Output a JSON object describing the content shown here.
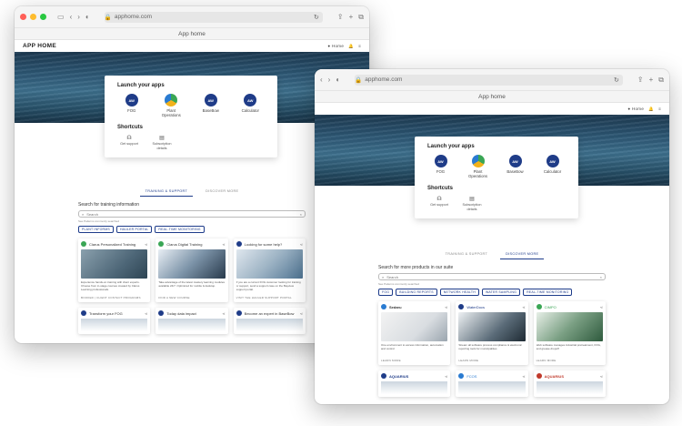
{
  "window1": {
    "url": "apphome.com",
    "tab_title": "App home",
    "header": {
      "title": "APP HOME",
      "user": "Home"
    },
    "launch": {
      "heading": "Launch your apps",
      "apps": [
        {
          "label": "FOG",
          "color": "#1f3c88",
          "icon": "AW"
        },
        {
          "label": "Plant Operations",
          "color": "#3aa655",
          "icon": ""
        },
        {
          "label": "BaseBow",
          "color": "#1f3c88",
          "icon": "AW"
        },
        {
          "label": "Calculator",
          "color": "#1f3c88",
          "icon": "AW"
        }
      ]
    },
    "shortcuts": {
      "heading": "Shortcuts",
      "items": [
        {
          "label": "Get support"
        },
        {
          "label": "Subscription details"
        }
      ]
    },
    "tabs": [
      "TRAINING & SUPPORT",
      "DISCOVER MORE"
    ],
    "search": {
      "label": "Search for training information",
      "placeholder": "Search",
      "hint": "See Patterns commonly searched"
    },
    "chips": [
      "PLANT INFORMS",
      "HAULER PORTAL",
      "REAL-TIME MONITORING"
    ],
    "cards": [
      {
        "title": "Clarus Personalized Training",
        "text": "Experience hands-on training with client experts. Choose from in-stage courses created by Clarus Learning professionals.",
        "foot": "BOOKED | CLIENT CONTACT PROGRAMS"
      },
      {
        "title": "Clarus Digital Training",
        "text": "Take advantage of the latest mastery learning modules available 24/7. Optimized for mobile & desktop.",
        "foot": "FIND A NEW COURSE"
      },
      {
        "title": "Looking for some help?",
        "text": "If you are a current FOG customer looking for training or support, send a support case on the Bayview support portal.",
        "foot": "VISIT THE HAULER SUPPORT PORTAL"
      }
    ],
    "more_cards": [
      "Transform your FOG",
      "Today data impact",
      "Become an expert in BaseBow"
    ]
  },
  "window2": {
    "url": "apphome.com",
    "tab_title": "App home",
    "header": {
      "user": "Home"
    },
    "launch": {
      "heading": "Launch your apps",
      "apps": [
        {
          "label": "FOG",
          "color": "#1f3c88",
          "icon": "AW"
        },
        {
          "label": "Plant Operations",
          "color": "#3aa655",
          "icon": ""
        },
        {
          "label": "BaseBow",
          "color": "#1f3c88",
          "icon": "AW"
        },
        {
          "label": "Calculator",
          "color": "#1f3c88",
          "icon": "AW"
        }
      ]
    },
    "shortcuts": {
      "heading": "Shortcuts",
      "items": [
        {
          "label": "Get support"
        },
        {
          "label": "Subscription details"
        }
      ]
    },
    "tabs": [
      "TRAINING & SUPPORT",
      "DISCOVER MORE"
    ],
    "search": {
      "label": "Search for more products in our suite",
      "placeholder": "Search",
      "hint": "See Patterns commonly searched"
    },
    "chips": [
      "FOG",
      "BUILDING REPORTS",
      "NETWORK HEALTH",
      "WATER SAMPLING",
      "REAL-TIME MONITORING"
    ],
    "cards": [
      {
        "brand": "Sedaru",
        "text": "One environment to access information, automation and control",
        "foot": "LEARN MORE"
      },
      {
        "brand": "WaterDocs",
        "text": "Stream all software process compliance & electronic reporting tools for municipalities",
        "foot": "LEARN MORE"
      },
      {
        "brand": "CIMPO",
        "text": "Web software manages industrial pretreatment, FOG, and grease dropoff",
        "foot": "LEARN MORE"
      }
    ],
    "more_cards": [
      "AQUARIUS",
      "FCOS",
      "AQUARIUS"
    ]
  }
}
